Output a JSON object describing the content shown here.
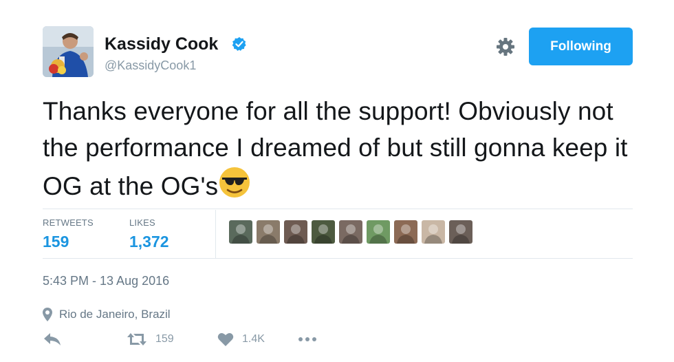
{
  "header": {
    "display_name": "Kassidy Cook",
    "handle": "@KassidyCook1",
    "follow_button_label": "Following"
  },
  "tweet": {
    "text": "Thanks everyone for all the support! Obviously not the performance I dreamed of but still gonna keep it OG at the OG's",
    "emoji": "sunglasses-face"
  },
  "stats": {
    "retweets_label": "RETWEETS",
    "retweets_value": "159",
    "likes_label": "LIKES",
    "likes_value": "1,372"
  },
  "likers": [
    {
      "color": "#5a6a5c"
    },
    {
      "color": "#8a7b6a"
    },
    {
      "color": "#6e5b52"
    },
    {
      "color": "#4d5a3f"
    },
    {
      "color": "#7a6a62"
    },
    {
      "color": "#6f9a63"
    },
    {
      "color": "#8c6a55"
    },
    {
      "color": "#c9b7a5"
    },
    {
      "color": "#6b5f58"
    }
  ],
  "meta": {
    "timestamp": "5:43 PM - 13 Aug 2016",
    "location": "Rio de Janeiro, Brazil"
  },
  "actions": {
    "retweet_count": "159",
    "like_count": "1.4K"
  },
  "colors": {
    "accent": "#1da1f2",
    "link_blue": "#1b95e0",
    "muted": "#657786",
    "icon_gray": "#8899a6"
  }
}
